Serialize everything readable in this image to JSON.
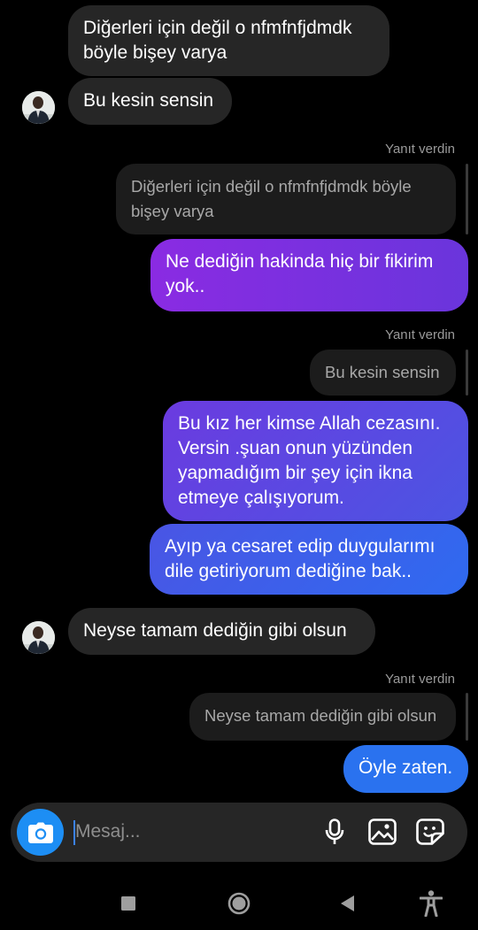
{
  "messages": {
    "m1": "Diğerleri için değil o nfmfnfjdmdk\nböyle bişey varya",
    "m2": "Bu kesin sensin",
    "r1_label": "Yanıt verdin",
    "r1_quote": "Diğerleri için değil o nfmfnfjdmdk böyle\nbişey varya",
    "m3": "Ne dediğin hakinda hiç bir fikirim\nyok..",
    "r2_label": "Yanıt verdin",
    "r2_quote": "Bu kesin sensin",
    "m4": "Bu kız her kimse Allah cezasını.\nVersin .şuan onun yüzünden\nyapmadığım bir şey  için ikna\netmeye çalışıyorum.",
    "m5": "Ayıp ya  cesaret edip duygularımı\ndile getiriyorum dediğine bak..",
    "m6": "Neyse tamam dediğin gibi olsun",
    "r3_label": "Yanıt verdin",
    "r3_quote": "Neyse tamam dediğin gibi olsun",
    "m7": "Öyle zaten."
  },
  "composer": {
    "placeholder": "Mesaj...",
    "icons": [
      "camera-icon",
      "microphone-icon",
      "gallery-icon",
      "sticker-icon"
    ]
  },
  "navbar": {
    "icons": [
      "recents-icon",
      "home-icon",
      "back-icon",
      "accessibility-icon"
    ]
  },
  "colors": {
    "background": "#000000",
    "incoming_bubble": "#262626",
    "quoted_bubble": "#1c1c1c",
    "gradient_purple": "#7b2fd6",
    "gradient_blue": "#2563eb",
    "camera_button": "#1d8ef4"
  }
}
